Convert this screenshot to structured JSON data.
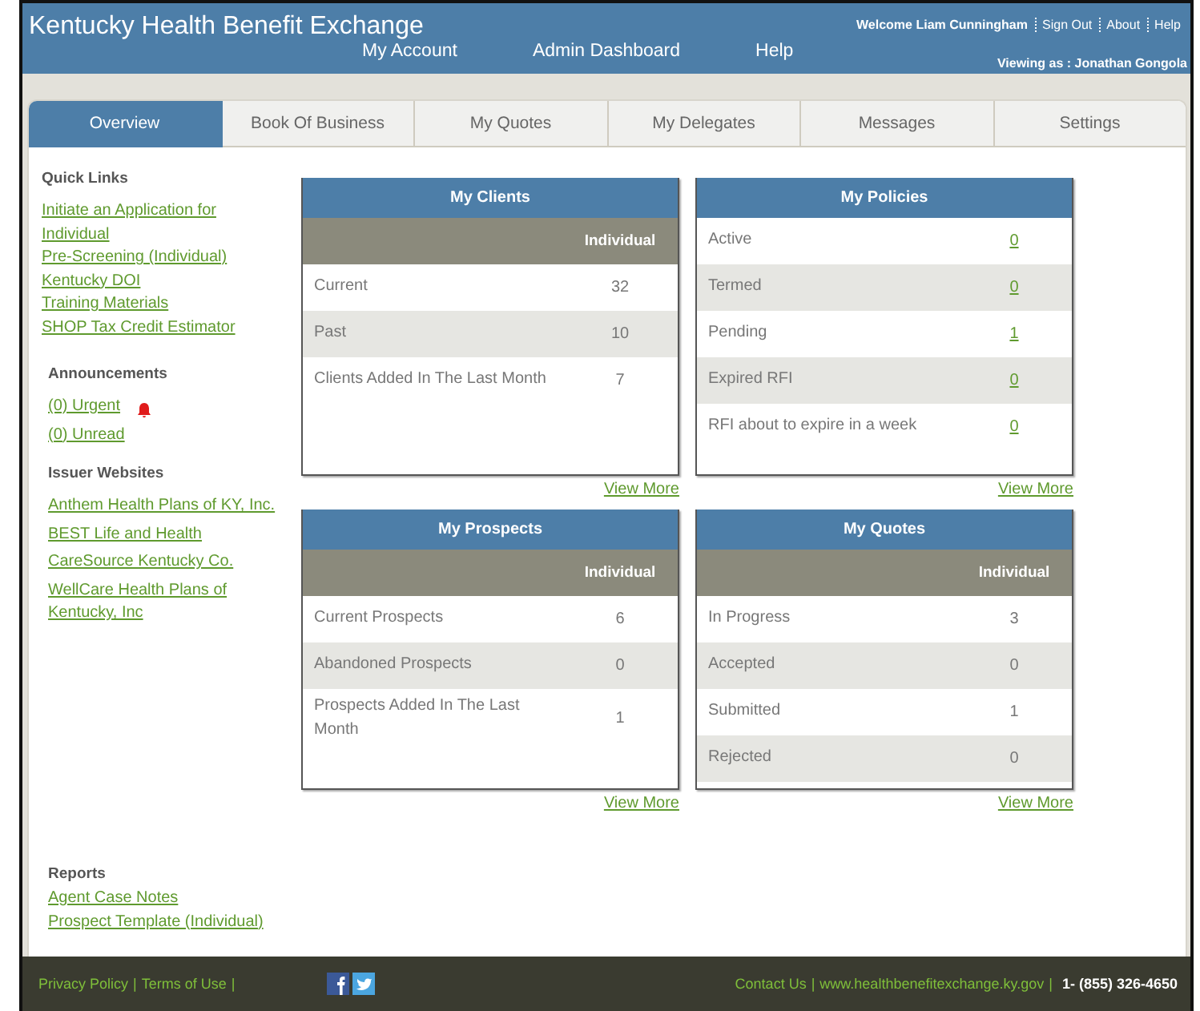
{
  "header": {
    "title": "Kentucky Health Benefit Exchange",
    "nav": [
      "My Account",
      "Admin Dashboard",
      "Help"
    ],
    "welcome": "Welcome Liam Cunningham",
    "user_links": [
      "Sign Out",
      "About",
      "Help"
    ],
    "viewing_as": "Viewing as : Jonathan Gongola"
  },
  "tabs": [
    {
      "label": "Overview",
      "selected": true
    },
    {
      "label": "Book Of Business",
      "selected": false
    },
    {
      "label": "My Quotes",
      "selected": false
    },
    {
      "label": "My Delegates",
      "selected": false
    },
    {
      "label": "Messages",
      "selected": false
    },
    {
      "label": "Settings",
      "selected": false
    }
  ],
  "sidebar": {
    "sections": [
      {
        "heading": "Quick Links",
        "kind": "plain",
        "links": [
          "Initiate an Application for Individual",
          "Pre-Screening (Individual)",
          "Kentucky DOI",
          "Training Materials",
          "SHOP Tax Credit Estimator"
        ]
      },
      {
        "heading": "Announcements",
        "kind": "spaced",
        "links": [
          {
            "label": "(0) Urgent",
            "bell": true
          },
          {
            "label": "(0) Unread",
            "bell": false
          }
        ]
      },
      {
        "heading": "Issuer Websites",
        "kind": "spaced",
        "links": [
          "Anthem Health Plans of KY, Inc.",
          "BEST Life and Health",
          "CareSource Kentucky Co.",
          "WellCare Health Plans of Kentucky, Inc"
        ]
      }
    ],
    "reports": {
      "heading": "Reports",
      "links": [
        "Agent Case Notes",
        "Prospect Template (Individual)"
      ]
    }
  },
  "cards": [
    {
      "title": "My Clients",
      "column": "Individual",
      "linked_values": false,
      "rows": [
        {
          "label": "Current",
          "value": "32"
        },
        {
          "label": "Past",
          "value": "10"
        },
        {
          "label": "Clients Added In The Last Month",
          "value": "7"
        }
      ],
      "more": "View More"
    },
    {
      "title": "My Policies",
      "linked_values": true,
      "rows": [
        {
          "label": "Active",
          "value": "0"
        },
        {
          "label": "Termed",
          "value": "0"
        },
        {
          "label": "Pending",
          "value": "1"
        },
        {
          "label": "Expired RFI",
          "value": "0"
        },
        {
          "label": "RFI about to expire in a week",
          "value": "0"
        }
      ],
      "more": "View More"
    },
    {
      "title": "My Prospects",
      "column": "Individual",
      "linked_values": false,
      "rows": [
        {
          "label": "Current Prospects",
          "value": "6"
        },
        {
          "label": "Abandoned Prospects",
          "value": "0"
        },
        {
          "label": "Prospects Added In The Last Month",
          "value": "1"
        }
      ],
      "more": "View More"
    },
    {
      "title": "My Quotes",
      "column": "Individual",
      "linked_values": false,
      "rows": [
        {
          "label": "In Progress",
          "value": "3"
        },
        {
          "label": "Accepted",
          "value": "0"
        },
        {
          "label": "Submitted",
          "value": "1"
        },
        {
          "label": "Rejected",
          "value": "0"
        }
      ],
      "more": "View More"
    }
  ],
  "footer": {
    "left_links": [
      "Privacy Policy",
      "Terms of Use"
    ],
    "separator": "|",
    "right_links": [
      "Contact Us",
      "www.healthbenefitexchange.ky.gov"
    ],
    "phone": "1- (855) 326-4650"
  }
}
